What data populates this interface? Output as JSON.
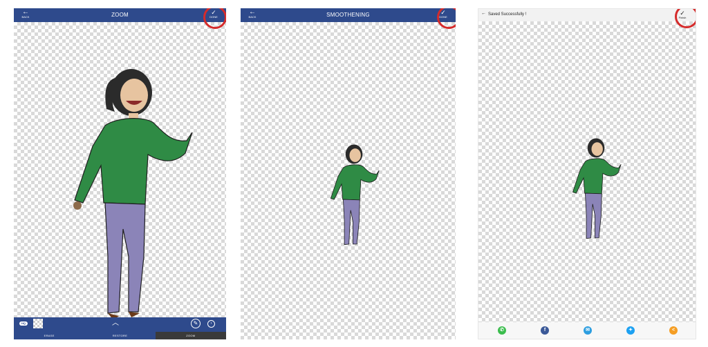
{
  "screen1": {
    "topbar": {
      "back_label": "BACK",
      "title": "ZOOM",
      "done_label": "DONE"
    },
    "toolbar": {
      "hq_badge": "HQ"
    },
    "tabs": [
      "ERASE",
      "RESTORE",
      "ZOOM"
    ],
    "active_tab": "ZOOM"
  },
  "screen2": {
    "topbar": {
      "back_label": "BACK",
      "title": "SMOOTHENING",
      "done_label": "DONE"
    }
  },
  "screen3": {
    "topbar": {
      "title": "Saved Successfully !",
      "finish_label": "Finish"
    },
    "share": [
      {
        "name": "whatsapp",
        "color": "#3bbd4d",
        "glyph": "✆"
      },
      {
        "name": "facebook",
        "color": "#3b5998",
        "glyph": "f"
      },
      {
        "name": "messenger",
        "color": "#2d9ee0",
        "glyph": "✉"
      },
      {
        "name": "twitter",
        "color": "#1da1f2",
        "glyph": "✦"
      },
      {
        "name": "share",
        "color": "#f59e24",
        "glyph": "<"
      }
    ]
  },
  "colors": {
    "bar": "#2e4a8c",
    "highlight_ring": "#d52b2b",
    "sweater": "#2f8b45",
    "pants": "#8b84b8",
    "hair": "#2b2b2b"
  }
}
